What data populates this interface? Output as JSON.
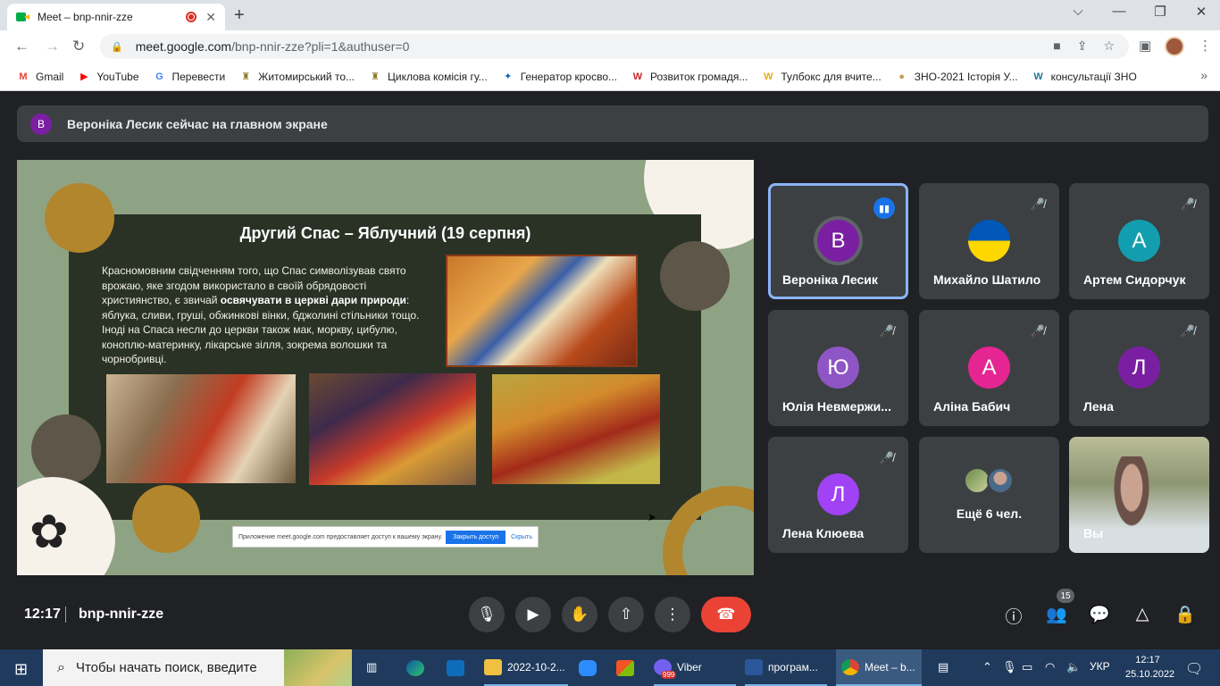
{
  "browser": {
    "tab": {
      "title": "Meet – bnp-nnir-zze",
      "close": "✕"
    },
    "new_tab": "+",
    "window": {
      "minimize": "⌵",
      "min": "—",
      "max": "❐",
      "close": "✕"
    },
    "nav": {
      "back": "←",
      "forward": "→",
      "reload": "↻"
    },
    "url": {
      "host": "meet.google.com",
      "path": "/bnp-nnir-zze?pli=1&authuser=0"
    }
  },
  "bookmarks": [
    {
      "label": "Gmail",
      "color": "#ea4335",
      "glyph": "M"
    },
    {
      "label": "YouTube",
      "color": "#ff0000",
      "glyph": "▶"
    },
    {
      "label": "Перевести",
      "color": "#4285f4",
      "glyph": "G"
    },
    {
      "label": "Житомирський то...",
      "color": "#8a7a2a",
      "glyph": "♜"
    },
    {
      "label": "Циклова комісія гу...",
      "color": "#8a7a2a",
      "glyph": "♜"
    },
    {
      "label": "Генератор кросво...",
      "color": "#1565c0",
      "glyph": "✦"
    },
    {
      "label": "Розвиток громадя...",
      "color": "#c62828",
      "glyph": "W"
    },
    {
      "label": "Тулбокс для вчите...",
      "color": "#e6a817",
      "glyph": "W"
    },
    {
      "label": "ЗНО-2021 Історія У...",
      "color": "#c9a04a",
      "glyph": "●"
    },
    {
      "label": "консультації ЗНО",
      "color": "#21759b",
      "glyph": "W"
    }
  ],
  "meet": {
    "banner": {
      "initial": "В",
      "text": "Вероніка Лесик сейчас на главном экране"
    },
    "slide": {
      "title": "Другий Спас – Яблучний (19 серпня)",
      "text_a": "Красномовним свідченням того, що Спас символізував свято врожаю, яке згодом використало в своїй обрядовості християнство, є звичай ",
      "text_bold": "освячувати в церкві дари природи",
      "text_b": ": яблука, сливи, груші, обжинкові вінки, бджолині стільники тощо. Іноді на Спаса несли до церкви також мак, моркву, цибулю, коноплю-материнку, лікарське зілля, зокрема волошки та чорнобривці.",
      "share_notice": "Приложение meet.google.com предоставляет доступ к вашему экрану.",
      "share_stop": "Закрыть доступ",
      "share_hide": "Скрыть"
    },
    "participants": [
      {
        "name": "Вероніка Лесик",
        "initial": "В",
        "color": "#7b1fa2",
        "speaking": true
      },
      {
        "name": "Михайло Шатило",
        "initial": "",
        "color": "#0057b7",
        "speaking": false
      },
      {
        "name": "Артем Сидорчук",
        "initial": "А",
        "color": "#129eaf",
        "speaking": false
      },
      {
        "name": "Юлія Невмержи...",
        "initial": "Ю",
        "color": "#8e55c4",
        "speaking": false
      },
      {
        "name": "Аліна Бабич",
        "initial": "А",
        "color": "#e52592",
        "speaking": false
      },
      {
        "name": "Лена",
        "initial": "Л",
        "color": "#7b1fa2",
        "speaking": false
      },
      {
        "name": "Лена Клюева",
        "initial": "Л",
        "color": "#a142f4",
        "speaking": false
      }
    ],
    "more_label": "Ещё 6 чел.",
    "self_label": "Вы",
    "time": "12:17",
    "code": "bnp-nnir-zze",
    "people_count": "15"
  },
  "taskbar": {
    "search_placeholder": "Чтобы начать поиск, введите",
    "folder_label": "2022-10-2...",
    "viber_label": "Viber",
    "viber_badge": "999",
    "word_label": "програм...",
    "chrome_label": "Meet – b...",
    "lang": "УКР",
    "time": "12:17",
    "date": "25.10.2022"
  }
}
